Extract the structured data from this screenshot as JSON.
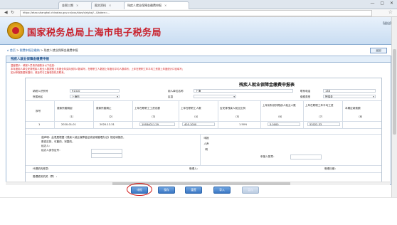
{
  "browser": {
    "tabs": [
      {
        "label": "金税三期",
        "close": "×"
      },
      {
        "label": "图文资料",
        "close": "×"
      },
      {
        "label": "残疾人就业保障金缴费申报",
        "close": "×"
      }
    ],
    "url": "https://etax.shanghai.chinatax.gov.cn/xxx/sbzs/cjrjybzj/...&token=...",
    "window_controls": "— ▢ ✕"
  },
  "site": {
    "title": "国家税务总局上海市电子税务局",
    "header_right": "【退出】"
  },
  "breadcrumb": {
    "home": "首页",
    "link": "税费申报及缴纳",
    "current": "残疾人就业保障金缴费申报",
    "sep": " > "
  },
  "back_button": "返回",
  "panel": {
    "title": "残疾人就业保障金缴费申报",
    "notice": [
      "温馨提示：填报人员请仔细核对以下信息：",
      "本年度用人单位安排残疾人就业人数按照上年度全年实际安排人数填写，在职职工人数按上年度月平均人数填写；上年在职职工年平均工资按上年度统计口径填写；",
      "如对申报数据有疑问，请及时与主管税务机关联系。"
    ]
  },
  "form": {
    "title": "残疾人就业保障金缴费申报表",
    "taxpayer_id_label": "纳税人识别号",
    "taxpayer_id_value": "91310",
    "unit_name_label": "用人单位名称",
    "unit_name_value": "上海",
    "contact_label": "联系电话",
    "contact_value": "138",
    "region_label": "所属地区",
    "region_value": "上海市",
    "district_label": "区县",
    "district_value": "",
    "sector_label": "缴费类型",
    "sector_value": "残保金",
    "col_headers": [
      "费款所属期起",
      "费款所属期止",
      "上年在职职工工资总额",
      "上年在职职工人数",
      "应安排残疾人就业比例",
      "上年实际安排残疾人就业人数",
      "上年在职职工年平均工资",
      "本期应纳费额"
    ],
    "col_nums": [
      "（1）",
      "（2）",
      "（3）",
      "（4）",
      "（5）",
      "（6）",
      "（7）",
      "（8）"
    ],
    "row": {
      "seq": "1",
      "start": "2020-01-01",
      "end": "2020-12-31",
      "wages": "19934011.29",
      "staff": "405.1000",
      "ratio": "1.50%",
      "disabled": "5.0000",
      "avg_wage": "53022.33",
      "amount": ""
    },
    "declaration_text": [
      "谨声明：此表是根据《残疾人就业保障金征收使用管理办法》规定填报的，",
      "是真实的、可靠的、完整的。",
      "",
      "经办人：",
      "经办人身份证号："
    ],
    "declare_chars": "申报人声明",
    "right_decl": "申报人签章：",
    "agent_label": "代理机构签章：",
    "receive_label": "受理人：",
    "receive_date_label": "受理日期：",
    "tax_office_label": "受理税务机关（章）："
  },
  "actions": [
    {
      "label": "申报",
      "enabled": true
    },
    {
      "label": "保存",
      "enabled": true
    },
    {
      "label": "重置",
      "enabled": true
    },
    {
      "label": "导入",
      "enabled": true
    },
    {
      "label": "暂存",
      "enabled": false
    }
  ]
}
